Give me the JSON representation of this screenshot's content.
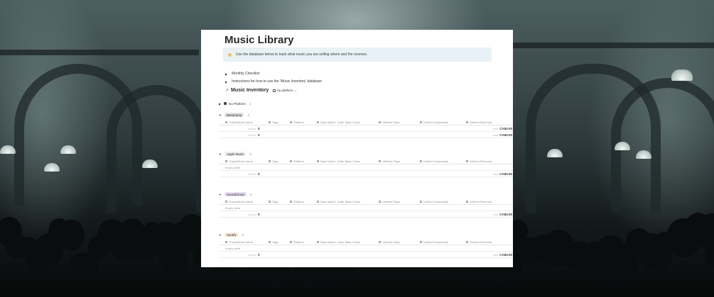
{
  "page": {
    "title": "Music Library",
    "callout": "Use the database below to track what music you are selling where and the revenue.",
    "toggles": [
      "Monthly Checklist",
      "Instructions for how to use the 'Music Inventory' database"
    ],
    "database": {
      "title": "Music Inventory",
      "view": "by platform"
    }
  },
  "no_platform": {
    "label": "No Platform",
    "count": "1"
  },
  "columns": [
    "Track/Album Name",
    "Tags",
    "Platform",
    "Date Added - Date Taken Down",
    "Lifetime Plays",
    "Lifetime Downloads",
    "Lifetime Revenue"
  ],
  "labels": {
    "count": "COUNT",
    "sum": "SUM",
    "empty": "Empty table"
  },
  "groups": [
    {
      "name": "Bandcamp",
      "count": "0",
      "color": "#e3e2e0",
      "count_value": "0",
      "sum_value": "CA$0.00",
      "footer_count": "0",
      "footer_sum": "CA$0.00"
    },
    {
      "name": "Apple Music",
      "count": "0",
      "color": "#ededeb",
      "count_value": "0",
      "sum_value": "CA$0.00"
    },
    {
      "name": "SoundCloud",
      "count": "0",
      "color": "#e8def8",
      "count_value": "0",
      "sum_value": "CA$0.00"
    },
    {
      "name": "Spotify",
      "count": "0",
      "color": "#fbecdd",
      "count_value": "0",
      "sum_value": "CA$0.00"
    }
  ],
  "colors": {
    "callout_bg": "#e7f1f6",
    "text": "#37352f"
  }
}
